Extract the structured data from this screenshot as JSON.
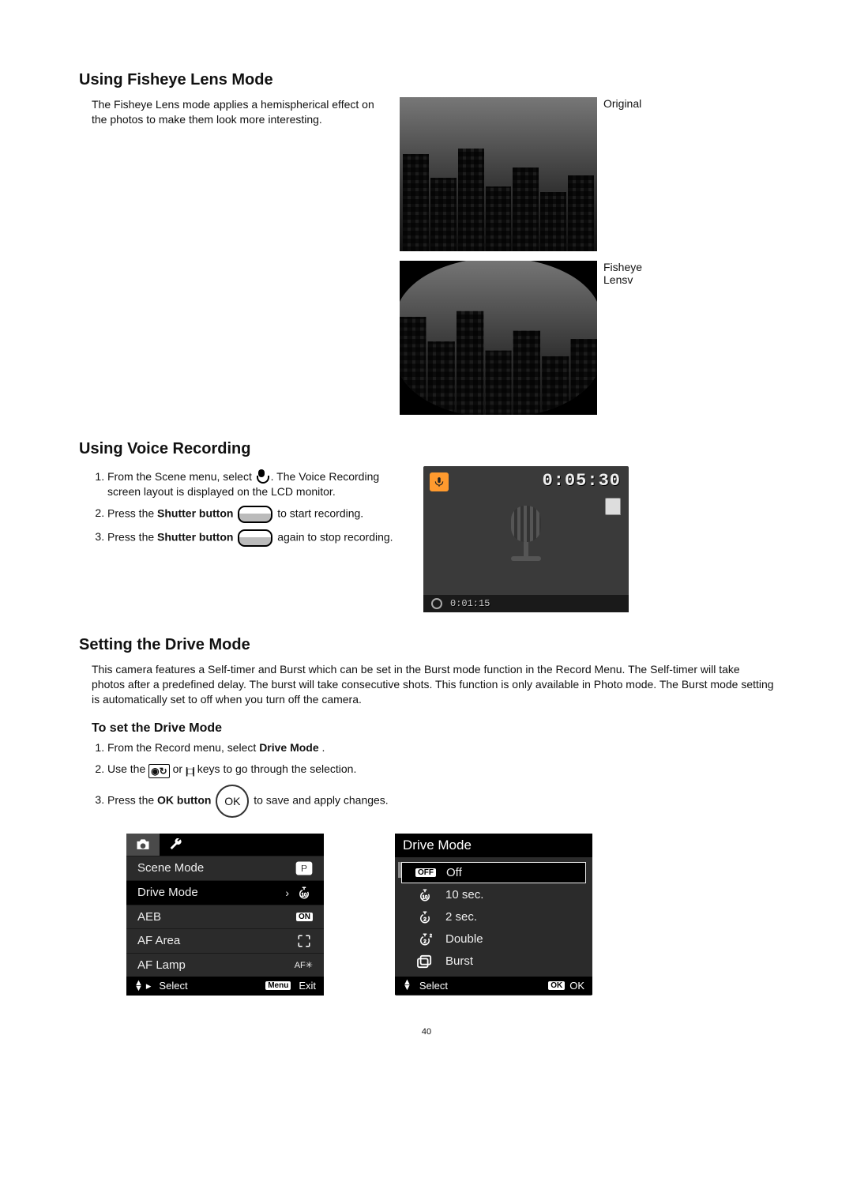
{
  "page_number": "40",
  "sec_fisheye": {
    "heading": "Using Fisheye Lens Mode",
    "intro": "The Fisheye Lens mode applies a hemispherical effect on the photos to make them look more interesting.",
    "label_original": "Original",
    "label_fisheye_1": "Fisheye",
    "label_fisheye_2": "Lensv"
  },
  "sec_voice": {
    "heading": "Using Voice Recording",
    "steps": {
      "s1a": "From the Scene menu, select ",
      "s1b": ". The Voice Recording screen layout is displayed on the LCD monitor.",
      "s2a": "Press the ",
      "s2b": "Shutter button",
      "s2c": " to start recording.",
      "s3a": "Press the ",
      "s3b": "Shutter button",
      "s3c": " again to stop recording."
    },
    "lcd": {
      "timer": "0:05:30",
      "elapsed": "0:01:15"
    }
  },
  "sec_drive": {
    "heading": "Setting the Drive Mode",
    "intro": "This camera features a Self-timer and Burst which can be set in the Burst mode function in the Record Menu. The Self-timer will take photos after a predefined delay. The burst will take consecutive shots. This function is only available in Photo mode. The Burst mode setting is automatically set to off when you turn off the camera.",
    "sub_heading": "To set the Drive Mode",
    "steps": {
      "s1a": "From the Record menu, select ",
      "s1b": "Drive Mode",
      "s1c": ".",
      "s2a": "Use the ",
      "s2b": " or ",
      "s2c": " keys to go through the selection.",
      "s3a": "Press the ",
      "s3b": "OK button",
      "s3c": " to save and apply changes."
    }
  },
  "record_menu": {
    "items": [
      {
        "label": "Scene Mode",
        "value_icon": "program-p-icon"
      },
      {
        "label": "Drive Mode",
        "value_icon": "timer-10-icon",
        "selected": true
      },
      {
        "label": "AEB",
        "value_badge": "ON"
      },
      {
        "label": "AF Area",
        "value_icon": "af-area-icon"
      },
      {
        "label": "AF Lamp",
        "value_text": "AF✳"
      }
    ],
    "footer": {
      "select": "Select",
      "menu_badge": "Menu",
      "exit": "Exit"
    }
  },
  "drive_menu": {
    "title": "Drive Mode",
    "options": [
      {
        "icon": "off-badge-icon",
        "label": "Off",
        "selected": true
      },
      {
        "icon": "timer-10-icon",
        "label": "10 sec."
      },
      {
        "icon": "timer-2-icon",
        "label": "2 sec."
      },
      {
        "icon": "timer-double-icon",
        "label": "Double"
      },
      {
        "icon": "burst-icon",
        "label": "Burst"
      }
    ],
    "footer": {
      "select": "Select",
      "ok_badge": "OK",
      "ok": "OK"
    }
  }
}
